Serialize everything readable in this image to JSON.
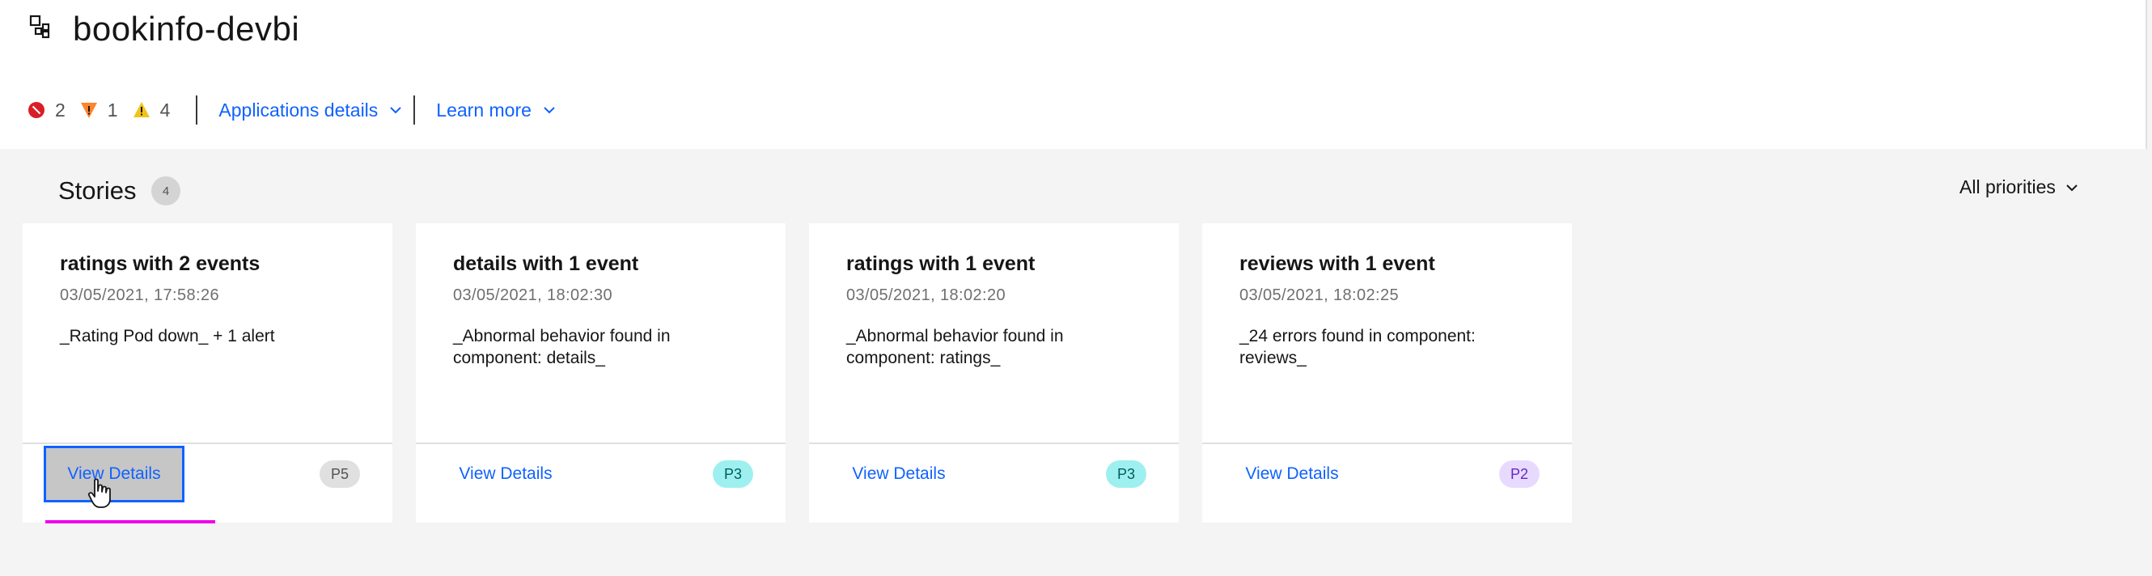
{
  "app": {
    "title": "bookinfo-devbi",
    "icon": "application-group-icon"
  },
  "status": {
    "critical_count": "2",
    "major_count": "1",
    "minor_count": "4",
    "colors": {
      "critical": "#da1e28",
      "major": "#ff832b",
      "minor": "#f1c21b"
    }
  },
  "header_links": {
    "app_details": "Applications details",
    "learn_more": "Learn more"
  },
  "stories": {
    "title": "Stories",
    "count": "4",
    "priority_filter": "All priorities",
    "cards": [
      {
        "title": "ratings with 2 events",
        "date": "03/05/2021, 17:58:26",
        "desc": "_Rating Pod down_ + 1 alert",
        "action": "View Details",
        "priority": "P5",
        "priority_bg": "#e0e0e0",
        "priority_fg": "#525252"
      },
      {
        "title": "details with 1 event",
        "date": "03/05/2021, 18:02:30",
        "desc": "_Abnormal behavior found in component: details_",
        "action": "View Details",
        "priority": "P3",
        "priority_bg": "#9ef0f0",
        "priority_fg": "#005d5d"
      },
      {
        "title": "ratings with 1 event",
        "date": "03/05/2021, 18:02:20",
        "desc": "_Abnormal behavior found in component: ratings_",
        "action": "View Details",
        "priority": "P3",
        "priority_bg": "#9ef0f0",
        "priority_fg": "#005d5d"
      },
      {
        "title": "reviews with 1 event",
        "date": "03/05/2021, 18:02:25",
        "desc": "_24 errors found in component: reviews_",
        "action": "View Details",
        "priority": "P2",
        "priority_bg": "#e8daff",
        "priority_fg": "#6929c4"
      }
    ]
  }
}
